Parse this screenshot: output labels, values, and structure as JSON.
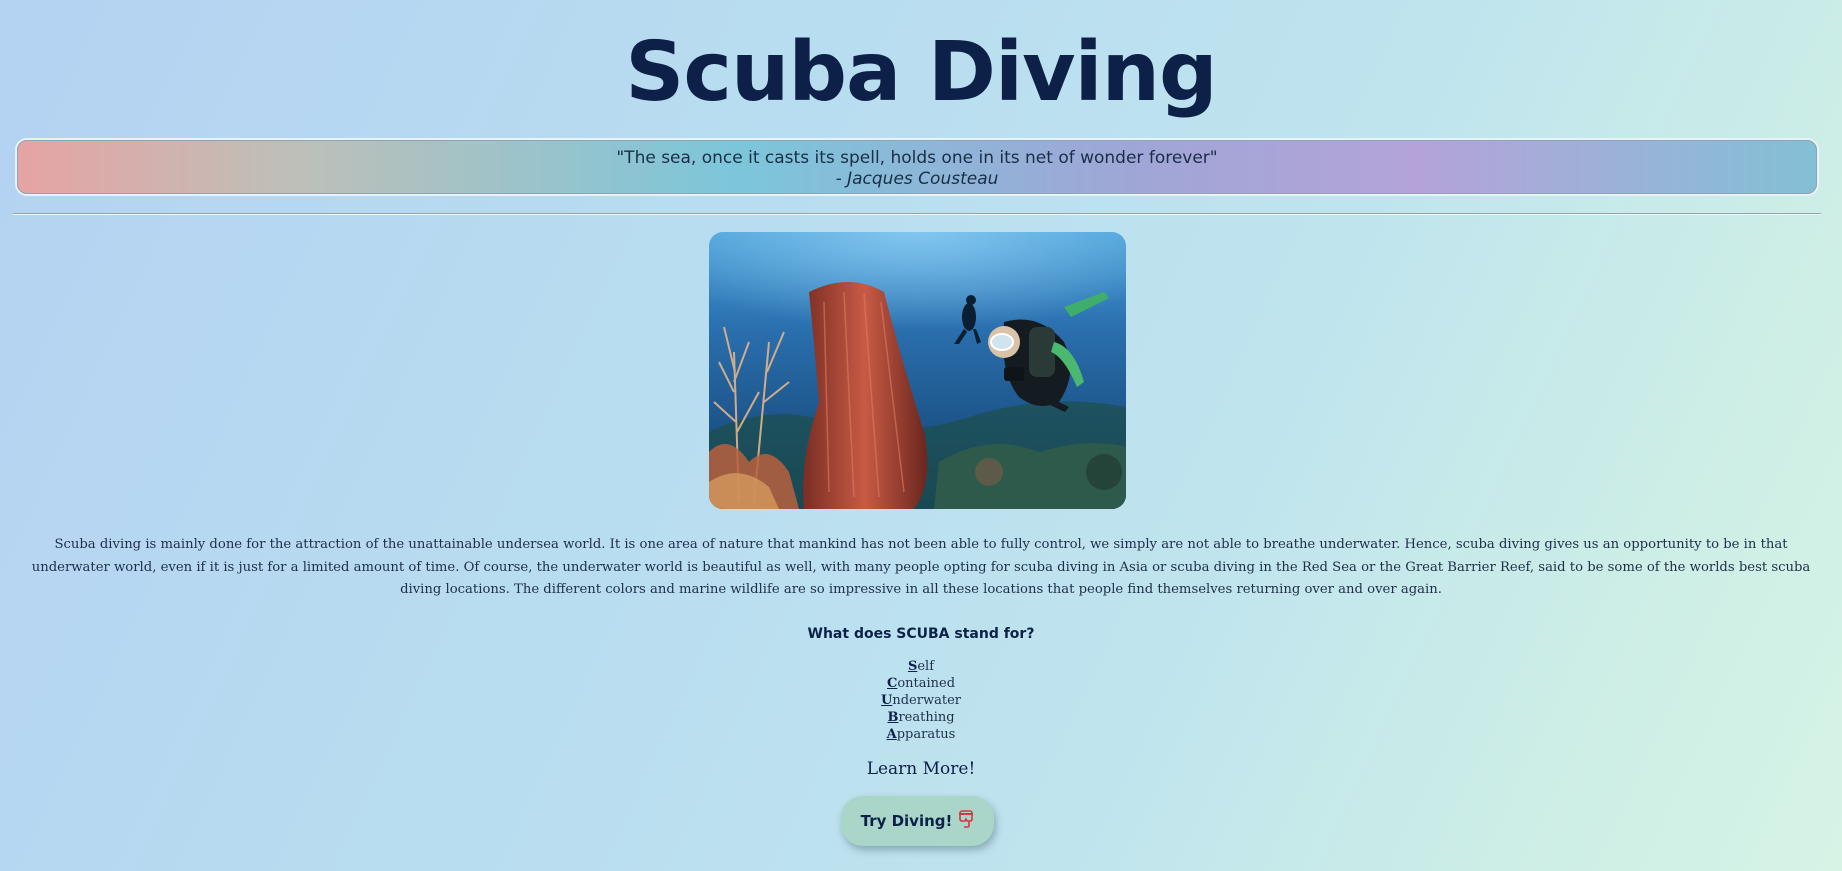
{
  "page": {
    "title": "Scuba Diving"
  },
  "quote": {
    "text": "\"The sea, once it casts its spell, holds one in its net of wonder forever\"",
    "author": "- Jacques Cousteau"
  },
  "hero_image": {
    "alt": "Scuba diver next to a large barrel sponge on a coral reef"
  },
  "description": "Scuba diving is mainly done for the attraction of the unattainable undersea world. It is one area of nature that mankind has not been able to fully control, we simply are not able to breathe underwater. Hence, scuba diving gives us an opportunity to be in that underwater world, even if it is just for a limited amount of time. Of course, the underwater world is beautiful as well, with many people opting for scuba diving in Asia or scuba diving in the Red Sea or the Great Barrier Reef, said to be some of the worlds best scuba diving locations. The different colors and marine wildlife are so impressive in all these locations that people find themselves returning over and over again.",
  "acronym": {
    "question": "What does SCUBA stand for?",
    "items": [
      {
        "letter": "S",
        "rest": "elf"
      },
      {
        "letter": "C",
        "rest": "ontained"
      },
      {
        "letter": "U",
        "rest": "nderwater"
      },
      {
        "letter": "B",
        "rest": "reathing"
      },
      {
        "letter": "A",
        "rest": "pparatus"
      }
    ]
  },
  "cta": {
    "learn_more": "Learn More!",
    "button_label": "Try Diving!",
    "button_icon": "diving-mask-icon"
  },
  "colors": {
    "title": "#0d2148",
    "button_bg": "#a9d6c8"
  }
}
